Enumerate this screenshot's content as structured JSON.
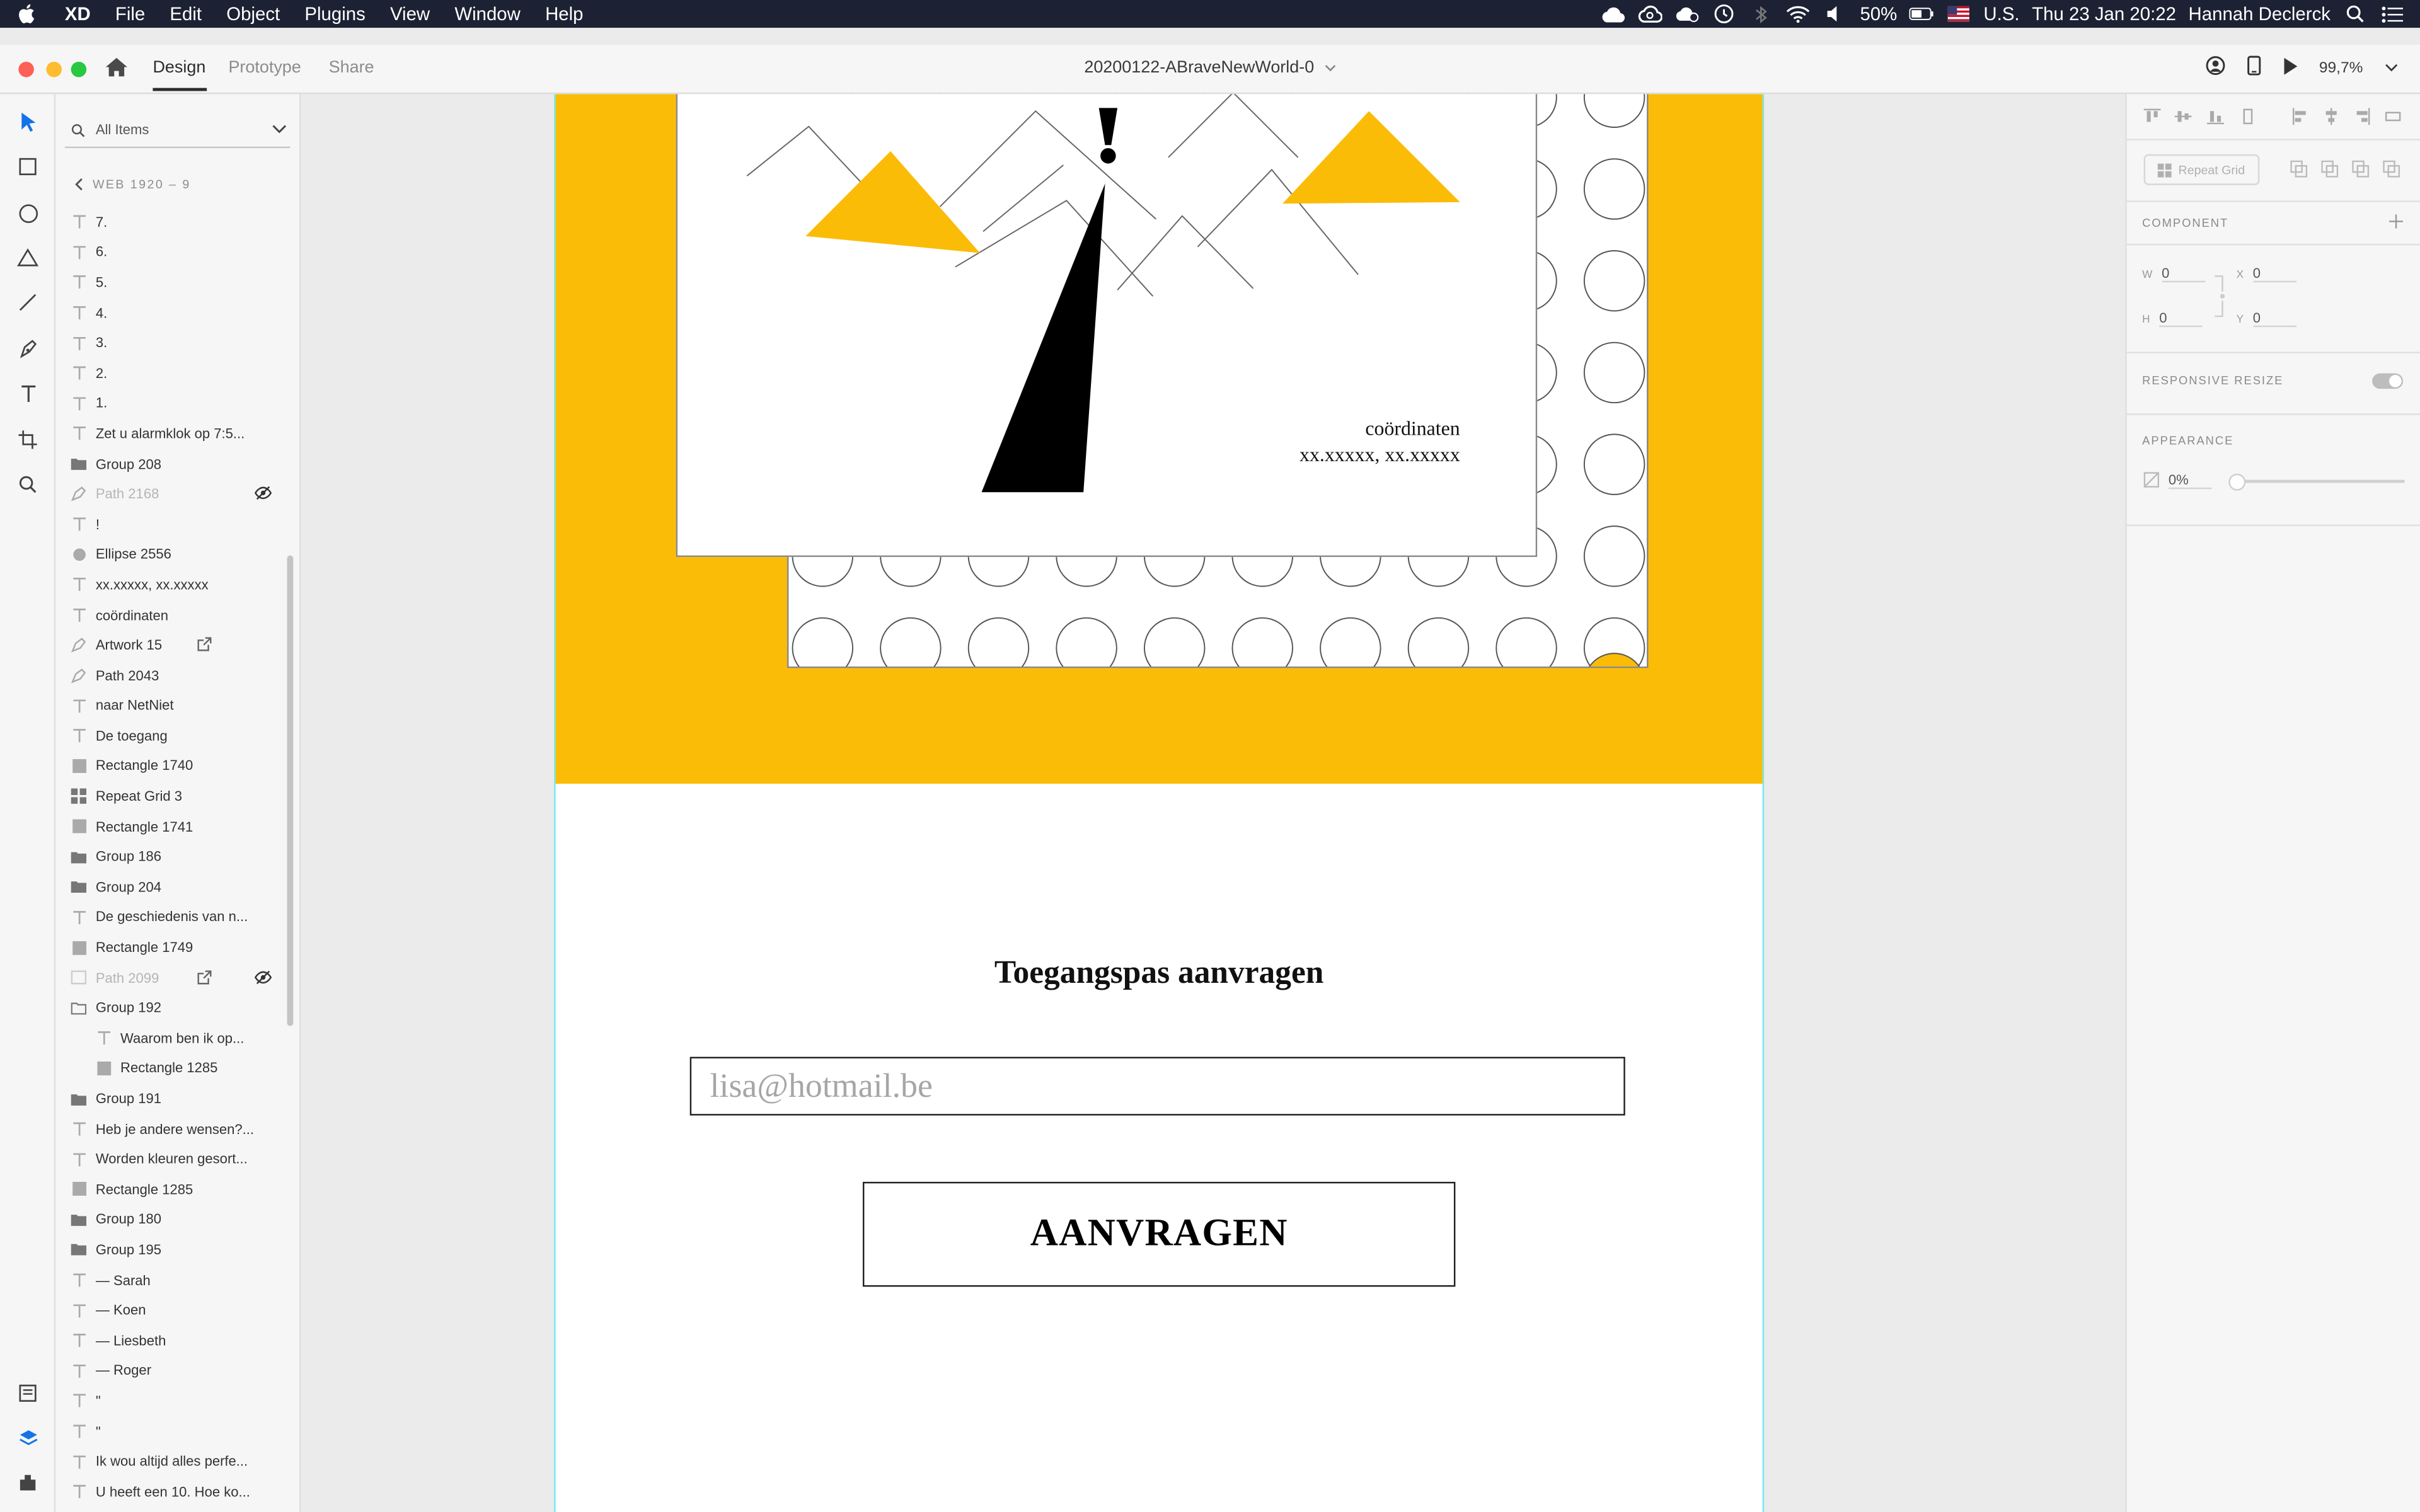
{
  "menubar": {
    "app_name": "XD",
    "menus": [
      "File",
      "Edit",
      "Object",
      "Plugins",
      "View",
      "Window",
      "Help"
    ],
    "battery": "50%",
    "input_source": "U.S.",
    "datetime": "Thu 23 Jan  20:22",
    "user": "Hannah Declerck"
  },
  "titlebar": {
    "tabs": [
      "Design",
      "Prototype",
      "Share"
    ],
    "active_tab": "Design",
    "document_title": "20200122-ABraveNewWorld-0",
    "zoom": "99,7%"
  },
  "layers_panel": {
    "search_placeholder": "All Items",
    "artboard_breadcrumb": "WEB 1920 – 9",
    "items": [
      {
        "name": "7.",
        "icon": "text-icon"
      },
      {
        "name": "6.",
        "icon": "text-icon"
      },
      {
        "name": "5.",
        "icon": "text-icon"
      },
      {
        "name": "4.",
        "icon": "text-icon"
      },
      {
        "name": "3.",
        "icon": "text-icon"
      },
      {
        "name": "2.",
        "icon": "text-icon"
      },
      {
        "name": "1.",
        "icon": "text-icon"
      },
      {
        "name": "Zet u alarmklok op 7:5...",
        "icon": "text-icon"
      },
      {
        "name": "Group 208",
        "icon": "folder-icon"
      },
      {
        "name": "Path 2168",
        "icon": "path-icon",
        "hidden": true
      },
      {
        "name": "!",
        "icon": "text-icon"
      },
      {
        "name": "Ellipse 2556",
        "icon": "ellipse-icon"
      },
      {
        "name": "xx.xxxxx, xx.xxxxx",
        "icon": "text-icon"
      },
      {
        "name": "coördinaten",
        "icon": "text-icon"
      },
      {
        "name": "Artwork 15",
        "icon": "path-icon",
        "linked": true
      },
      {
        "name": "Path 2043",
        "icon": "path-icon"
      },
      {
        "name": "naar NetNiet",
        "icon": "text-icon"
      },
      {
        "name": "De toegang",
        "icon": "text-icon"
      },
      {
        "name": "Rectangle 1740",
        "icon": "rectangle-icon"
      },
      {
        "name": "Repeat Grid 3",
        "icon": "repeat-grid-icon"
      },
      {
        "name": "Rectangle 1741",
        "icon": "rectangle-icon"
      },
      {
        "name": "Group 186",
        "icon": "folder-icon"
      },
      {
        "name": "Group 204",
        "icon": "folder-icon"
      },
      {
        "name": "De geschiedenis van n...",
        "icon": "text-icon"
      },
      {
        "name": "Rectangle 1749",
        "icon": "rectangle-icon"
      },
      {
        "name": "Path 2099",
        "icon": "image-icon",
        "hidden": true,
        "linked": true
      },
      {
        "name": "Group 192",
        "icon": "folder-open-icon"
      },
      {
        "name": "Waarom ben ik op...",
        "icon": "text-icon",
        "child": true
      },
      {
        "name": "Rectangle 1285",
        "icon": "rectangle-icon",
        "child": true
      },
      {
        "name": "Group 191",
        "icon": "folder-icon"
      },
      {
        "name": "Heb je andere wensen?...",
        "icon": "text-icon"
      },
      {
        "name": "Worden kleuren gesort...",
        "icon": "text-icon"
      },
      {
        "name": "Rectangle 1285",
        "icon": "rectangle-icon"
      },
      {
        "name": "Group 180",
        "icon": "folder-icon"
      },
      {
        "name": "Group 195",
        "icon": "folder-icon"
      },
      {
        "name": "— Sarah",
        "icon": "text-icon"
      },
      {
        "name": "— Koen",
        "icon": "text-icon"
      },
      {
        "name": "— Liesbeth",
        "icon": "text-icon"
      },
      {
        "name": "— Roger",
        "icon": "text-icon"
      },
      {
        "name": "\"",
        "icon": "text-icon"
      },
      {
        "name": "\"",
        "icon": "text-icon"
      },
      {
        "name": "Ik wou altijd alles perfe...",
        "icon": "text-icon"
      },
      {
        "name": "U heeft een 10. Hoe ko...",
        "icon": "text-icon"
      }
    ]
  },
  "artboard": {
    "coord_label": "coördinaten",
    "coord_value": "xx.xxxxx, xx.xxxxx",
    "form_heading": "Toegangspas aanvragen",
    "email_placeholder": "lisa@hotmail.be",
    "submit_label": "AANVRAGEN",
    "colors": {
      "accent": "#fbbc08",
      "ink": "#000000",
      "guide": "#72e8f0"
    }
  },
  "inspector": {
    "repeat_grid_label": "Repeat Grid",
    "component_label": "COMPONENT",
    "w_label": "W",
    "w_value": "0",
    "h_label": "H",
    "h_value": "0",
    "x_label": "X",
    "x_value": "0",
    "y_label": "Y",
    "y_value": "0",
    "responsive_label": "RESPONSIVE RESIZE",
    "appearance_label": "APPEARANCE",
    "opacity_value": "0%"
  }
}
